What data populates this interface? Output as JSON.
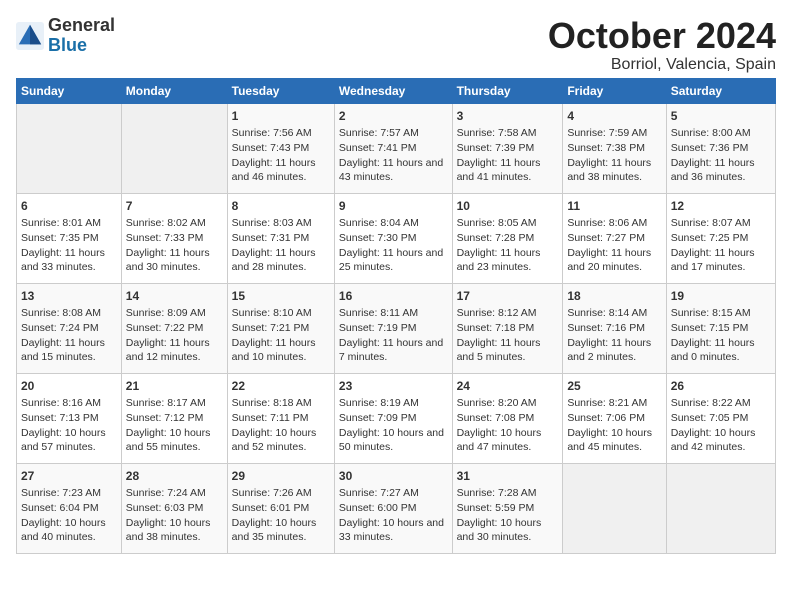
{
  "header": {
    "logo_general": "General",
    "logo_blue": "Blue",
    "month_title": "October 2024",
    "location": "Borriol, Valencia, Spain"
  },
  "calendar": {
    "weekdays": [
      "Sunday",
      "Monday",
      "Tuesday",
      "Wednesday",
      "Thursday",
      "Friday",
      "Saturday"
    ],
    "rows": [
      [
        {
          "day": "",
          "empty": true
        },
        {
          "day": "",
          "empty": true
        },
        {
          "day": "1",
          "sunrise": "Sunrise: 7:56 AM",
          "sunset": "Sunset: 7:43 PM",
          "daylight": "Daylight: 11 hours and 46 minutes."
        },
        {
          "day": "2",
          "sunrise": "Sunrise: 7:57 AM",
          "sunset": "Sunset: 7:41 PM",
          "daylight": "Daylight: 11 hours and 43 minutes."
        },
        {
          "day": "3",
          "sunrise": "Sunrise: 7:58 AM",
          "sunset": "Sunset: 7:39 PM",
          "daylight": "Daylight: 11 hours and 41 minutes."
        },
        {
          "day": "4",
          "sunrise": "Sunrise: 7:59 AM",
          "sunset": "Sunset: 7:38 PM",
          "daylight": "Daylight: 11 hours and 38 minutes."
        },
        {
          "day": "5",
          "sunrise": "Sunrise: 8:00 AM",
          "sunset": "Sunset: 7:36 PM",
          "daylight": "Daylight: 11 hours and 36 minutes."
        }
      ],
      [
        {
          "day": "6",
          "sunrise": "Sunrise: 8:01 AM",
          "sunset": "Sunset: 7:35 PM",
          "daylight": "Daylight: 11 hours and 33 minutes."
        },
        {
          "day": "7",
          "sunrise": "Sunrise: 8:02 AM",
          "sunset": "Sunset: 7:33 PM",
          "daylight": "Daylight: 11 hours and 30 minutes."
        },
        {
          "day": "8",
          "sunrise": "Sunrise: 8:03 AM",
          "sunset": "Sunset: 7:31 PM",
          "daylight": "Daylight: 11 hours and 28 minutes."
        },
        {
          "day": "9",
          "sunrise": "Sunrise: 8:04 AM",
          "sunset": "Sunset: 7:30 PM",
          "daylight": "Daylight: 11 hours and 25 minutes."
        },
        {
          "day": "10",
          "sunrise": "Sunrise: 8:05 AM",
          "sunset": "Sunset: 7:28 PM",
          "daylight": "Daylight: 11 hours and 23 minutes."
        },
        {
          "day": "11",
          "sunrise": "Sunrise: 8:06 AM",
          "sunset": "Sunset: 7:27 PM",
          "daylight": "Daylight: 11 hours and 20 minutes."
        },
        {
          "day": "12",
          "sunrise": "Sunrise: 8:07 AM",
          "sunset": "Sunset: 7:25 PM",
          "daylight": "Daylight: 11 hours and 17 minutes."
        }
      ],
      [
        {
          "day": "13",
          "sunrise": "Sunrise: 8:08 AM",
          "sunset": "Sunset: 7:24 PM",
          "daylight": "Daylight: 11 hours and 15 minutes."
        },
        {
          "day": "14",
          "sunrise": "Sunrise: 8:09 AM",
          "sunset": "Sunset: 7:22 PM",
          "daylight": "Daylight: 11 hours and 12 minutes."
        },
        {
          "day": "15",
          "sunrise": "Sunrise: 8:10 AM",
          "sunset": "Sunset: 7:21 PM",
          "daylight": "Daylight: 11 hours and 10 minutes."
        },
        {
          "day": "16",
          "sunrise": "Sunrise: 8:11 AM",
          "sunset": "Sunset: 7:19 PM",
          "daylight": "Daylight: 11 hours and 7 minutes."
        },
        {
          "day": "17",
          "sunrise": "Sunrise: 8:12 AM",
          "sunset": "Sunset: 7:18 PM",
          "daylight": "Daylight: 11 hours and 5 minutes."
        },
        {
          "day": "18",
          "sunrise": "Sunrise: 8:14 AM",
          "sunset": "Sunset: 7:16 PM",
          "daylight": "Daylight: 11 hours and 2 minutes."
        },
        {
          "day": "19",
          "sunrise": "Sunrise: 8:15 AM",
          "sunset": "Sunset: 7:15 PM",
          "daylight": "Daylight: 11 hours and 0 minutes."
        }
      ],
      [
        {
          "day": "20",
          "sunrise": "Sunrise: 8:16 AM",
          "sunset": "Sunset: 7:13 PM",
          "daylight": "Daylight: 10 hours and 57 minutes."
        },
        {
          "day": "21",
          "sunrise": "Sunrise: 8:17 AM",
          "sunset": "Sunset: 7:12 PM",
          "daylight": "Daylight: 10 hours and 55 minutes."
        },
        {
          "day": "22",
          "sunrise": "Sunrise: 8:18 AM",
          "sunset": "Sunset: 7:11 PM",
          "daylight": "Daylight: 10 hours and 52 minutes."
        },
        {
          "day": "23",
          "sunrise": "Sunrise: 8:19 AM",
          "sunset": "Sunset: 7:09 PM",
          "daylight": "Daylight: 10 hours and 50 minutes."
        },
        {
          "day": "24",
          "sunrise": "Sunrise: 8:20 AM",
          "sunset": "Sunset: 7:08 PM",
          "daylight": "Daylight: 10 hours and 47 minutes."
        },
        {
          "day": "25",
          "sunrise": "Sunrise: 8:21 AM",
          "sunset": "Sunset: 7:06 PM",
          "daylight": "Daylight: 10 hours and 45 minutes."
        },
        {
          "day": "26",
          "sunrise": "Sunrise: 8:22 AM",
          "sunset": "Sunset: 7:05 PM",
          "daylight": "Daylight: 10 hours and 42 minutes."
        }
      ],
      [
        {
          "day": "27",
          "sunrise": "Sunrise: 7:23 AM",
          "sunset": "Sunset: 6:04 PM",
          "daylight": "Daylight: 10 hours and 40 minutes."
        },
        {
          "day": "28",
          "sunrise": "Sunrise: 7:24 AM",
          "sunset": "Sunset: 6:03 PM",
          "daylight": "Daylight: 10 hours and 38 minutes."
        },
        {
          "day": "29",
          "sunrise": "Sunrise: 7:26 AM",
          "sunset": "Sunset: 6:01 PM",
          "daylight": "Daylight: 10 hours and 35 minutes."
        },
        {
          "day": "30",
          "sunrise": "Sunrise: 7:27 AM",
          "sunset": "Sunset: 6:00 PM",
          "daylight": "Daylight: 10 hours and 33 minutes."
        },
        {
          "day": "31",
          "sunrise": "Sunrise: 7:28 AM",
          "sunset": "Sunset: 5:59 PM",
          "daylight": "Daylight: 10 hours and 30 minutes."
        },
        {
          "day": "",
          "empty": true
        },
        {
          "day": "",
          "empty": true
        }
      ]
    ]
  }
}
